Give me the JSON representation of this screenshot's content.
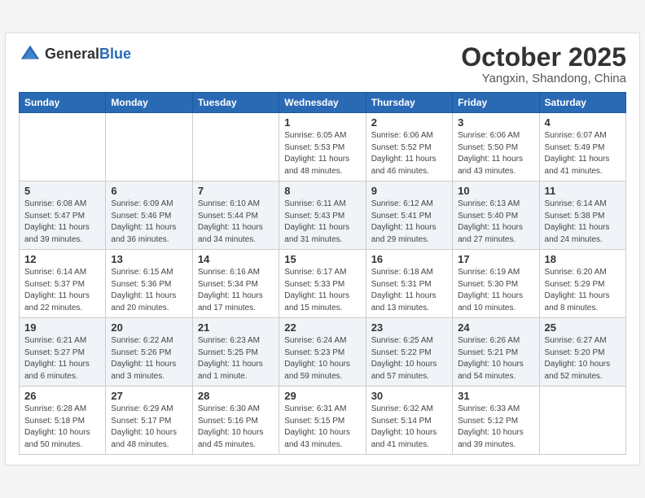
{
  "header": {
    "logo_general": "General",
    "logo_blue": "Blue",
    "month_title": "October 2025",
    "subtitle": "Yangxin, Shandong, China"
  },
  "weekdays": [
    "Sunday",
    "Monday",
    "Tuesday",
    "Wednesday",
    "Thursday",
    "Friday",
    "Saturday"
  ],
  "weeks": [
    [
      {
        "day": "",
        "info": ""
      },
      {
        "day": "",
        "info": ""
      },
      {
        "day": "",
        "info": ""
      },
      {
        "day": "1",
        "info": "Sunrise: 6:05 AM\nSunset: 5:53 PM\nDaylight: 11 hours\nand 48 minutes."
      },
      {
        "day": "2",
        "info": "Sunrise: 6:06 AM\nSunset: 5:52 PM\nDaylight: 11 hours\nand 46 minutes."
      },
      {
        "day": "3",
        "info": "Sunrise: 6:06 AM\nSunset: 5:50 PM\nDaylight: 11 hours\nand 43 minutes."
      },
      {
        "day": "4",
        "info": "Sunrise: 6:07 AM\nSunset: 5:49 PM\nDaylight: 11 hours\nand 41 minutes."
      }
    ],
    [
      {
        "day": "5",
        "info": "Sunrise: 6:08 AM\nSunset: 5:47 PM\nDaylight: 11 hours\nand 39 minutes."
      },
      {
        "day": "6",
        "info": "Sunrise: 6:09 AM\nSunset: 5:46 PM\nDaylight: 11 hours\nand 36 minutes."
      },
      {
        "day": "7",
        "info": "Sunrise: 6:10 AM\nSunset: 5:44 PM\nDaylight: 11 hours\nand 34 minutes."
      },
      {
        "day": "8",
        "info": "Sunrise: 6:11 AM\nSunset: 5:43 PM\nDaylight: 11 hours\nand 31 minutes."
      },
      {
        "day": "9",
        "info": "Sunrise: 6:12 AM\nSunset: 5:41 PM\nDaylight: 11 hours\nand 29 minutes."
      },
      {
        "day": "10",
        "info": "Sunrise: 6:13 AM\nSunset: 5:40 PM\nDaylight: 11 hours\nand 27 minutes."
      },
      {
        "day": "11",
        "info": "Sunrise: 6:14 AM\nSunset: 5:38 PM\nDaylight: 11 hours\nand 24 minutes."
      }
    ],
    [
      {
        "day": "12",
        "info": "Sunrise: 6:14 AM\nSunset: 5:37 PM\nDaylight: 11 hours\nand 22 minutes."
      },
      {
        "day": "13",
        "info": "Sunrise: 6:15 AM\nSunset: 5:36 PM\nDaylight: 11 hours\nand 20 minutes."
      },
      {
        "day": "14",
        "info": "Sunrise: 6:16 AM\nSunset: 5:34 PM\nDaylight: 11 hours\nand 17 minutes."
      },
      {
        "day": "15",
        "info": "Sunrise: 6:17 AM\nSunset: 5:33 PM\nDaylight: 11 hours\nand 15 minutes."
      },
      {
        "day": "16",
        "info": "Sunrise: 6:18 AM\nSunset: 5:31 PM\nDaylight: 11 hours\nand 13 minutes."
      },
      {
        "day": "17",
        "info": "Sunrise: 6:19 AM\nSunset: 5:30 PM\nDaylight: 11 hours\nand 10 minutes."
      },
      {
        "day": "18",
        "info": "Sunrise: 6:20 AM\nSunset: 5:29 PM\nDaylight: 11 hours\nand 8 minutes."
      }
    ],
    [
      {
        "day": "19",
        "info": "Sunrise: 6:21 AM\nSunset: 5:27 PM\nDaylight: 11 hours\nand 6 minutes."
      },
      {
        "day": "20",
        "info": "Sunrise: 6:22 AM\nSunset: 5:26 PM\nDaylight: 11 hours\nand 3 minutes."
      },
      {
        "day": "21",
        "info": "Sunrise: 6:23 AM\nSunset: 5:25 PM\nDaylight: 11 hours\nand 1 minute."
      },
      {
        "day": "22",
        "info": "Sunrise: 6:24 AM\nSunset: 5:23 PM\nDaylight: 10 hours\nand 59 minutes."
      },
      {
        "day": "23",
        "info": "Sunrise: 6:25 AM\nSunset: 5:22 PM\nDaylight: 10 hours\nand 57 minutes."
      },
      {
        "day": "24",
        "info": "Sunrise: 6:26 AM\nSunset: 5:21 PM\nDaylight: 10 hours\nand 54 minutes."
      },
      {
        "day": "25",
        "info": "Sunrise: 6:27 AM\nSunset: 5:20 PM\nDaylight: 10 hours\nand 52 minutes."
      }
    ],
    [
      {
        "day": "26",
        "info": "Sunrise: 6:28 AM\nSunset: 5:18 PM\nDaylight: 10 hours\nand 50 minutes."
      },
      {
        "day": "27",
        "info": "Sunrise: 6:29 AM\nSunset: 5:17 PM\nDaylight: 10 hours\nand 48 minutes."
      },
      {
        "day": "28",
        "info": "Sunrise: 6:30 AM\nSunset: 5:16 PM\nDaylight: 10 hours\nand 45 minutes."
      },
      {
        "day": "29",
        "info": "Sunrise: 6:31 AM\nSunset: 5:15 PM\nDaylight: 10 hours\nand 43 minutes."
      },
      {
        "day": "30",
        "info": "Sunrise: 6:32 AM\nSunset: 5:14 PM\nDaylight: 10 hours\nand 41 minutes."
      },
      {
        "day": "31",
        "info": "Sunrise: 6:33 AM\nSunset: 5:12 PM\nDaylight: 10 hours\nand 39 minutes."
      },
      {
        "day": "",
        "info": ""
      }
    ]
  ]
}
